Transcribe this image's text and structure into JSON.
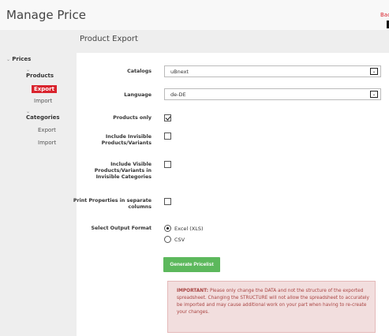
{
  "header": {
    "title": "Manage Price",
    "back_label": "Back"
  },
  "sidebar": {
    "prices": {
      "chevron": "⌄",
      "label": "Prices"
    },
    "products": {
      "chevron": "⌄",
      "label": "Products",
      "export": "Export",
      "import": "Import"
    },
    "categories": {
      "chevron": "⌄",
      "label": "Categories",
      "export": "Export",
      "import": "Import"
    }
  },
  "main": {
    "section_title": "Product Export",
    "form": {
      "catalogs": {
        "label": "Catalogs",
        "value": "uBnext"
      },
      "language": {
        "label": "Language",
        "value": "de-DE"
      },
      "products_only": {
        "label": "Products only",
        "checked": true
      },
      "include_invisible": {
        "label": "Include Invisible Products/Variants",
        "checked": false
      },
      "include_visible": {
        "label": "Include Visible Products/Variants in Invisible Categories",
        "checked": false
      },
      "print_properties": {
        "label": "Print Properties in separate columns",
        "checked": false
      },
      "output_format": {
        "label": "Select Output Format",
        "options": [
          "Excel (XLS)",
          "CSV"
        ],
        "selected": "Excel (XLS)"
      }
    },
    "generate_button": "Generate Pricelist",
    "notice": {
      "strong": "IMPORTANT:",
      "text": " Please only change the DATA and not the structure of the exported spreadsheet. Changing the STRUCTURE will not allow the spreadsheet to accurately be imported and may cause additional work on your part when having to re-create your changes."
    }
  },
  "colors": {
    "accent_red": "#d9232d",
    "button_green": "#5cb85c",
    "alert_bg": "#f2dede",
    "alert_text": "#a94442"
  },
  "icons": {
    "select_arrow": "chevron-down-icon",
    "tree_toggle": "chevron-down-icon"
  }
}
